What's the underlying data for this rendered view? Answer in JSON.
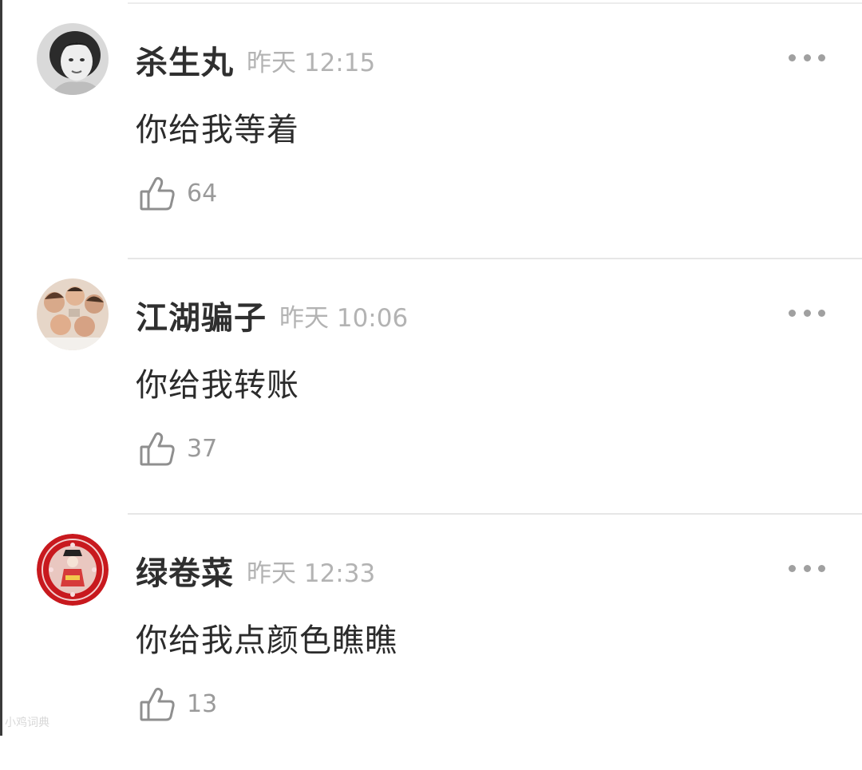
{
  "comments": [
    {
      "username": "杀生丸",
      "time": "昨天 12:15",
      "text": "你给我等着",
      "likes": "64",
      "avatar_style": "bw-portrait"
    },
    {
      "username": "江湖骗子",
      "time": "昨天 10:06",
      "text": "你给我转账",
      "likes": "37",
      "avatar_style": "group-photo"
    },
    {
      "username": "绿卷菜",
      "time": "昨天 12:33",
      "text": "你给我点颜色瞧瞧",
      "likes": "13",
      "avatar_style": "red-ornament"
    }
  ],
  "icons": {
    "like": "thumbs-up-icon",
    "more": "more-dots-icon"
  },
  "colors": {
    "username": "#2f2f2f",
    "time": "#b3b3b3",
    "count": "#9a9a9a",
    "divider": "#e6e6e6",
    "accent_red": "#c8191e"
  },
  "watermark": "小鸡词典"
}
